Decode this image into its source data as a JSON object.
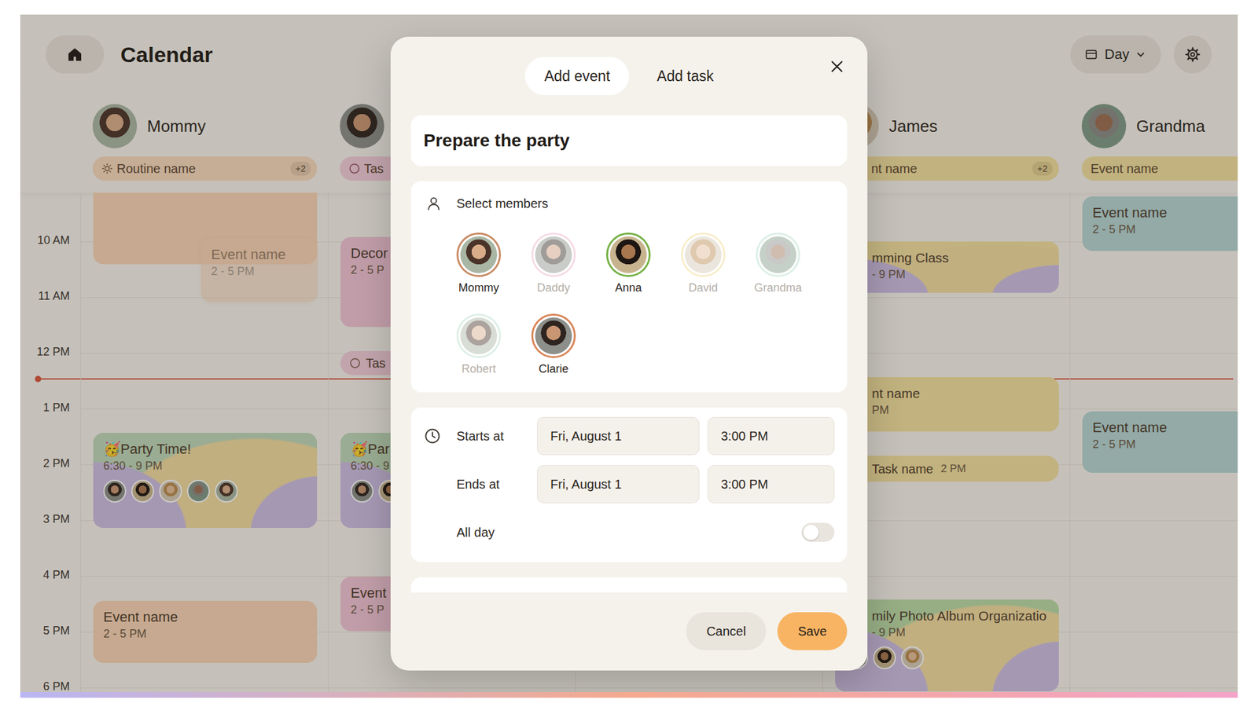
{
  "app": {
    "title": "Calendar",
    "view": "Day"
  },
  "columns": [
    {
      "name": "Mommy",
      "chip": {
        "kind": "routine",
        "label": "Routine name",
        "badge": "+2",
        "color": "#f6d8bd"
      },
      "events": [
        {
          "kind": "block",
          "title": null,
          "time": null,
          "color": "#f6d3b4",
          "attendees": 0
        },
        {
          "kind": "ghost",
          "title": "Event name",
          "time": "2 - 5 PM",
          "color": "#f6d3b4",
          "attendees": 0
        },
        {
          "kind": "pattern",
          "title": "🥳Party Time!",
          "time": "6:30 - 9 PM",
          "color": "#bcd6b8",
          "attendees": 5
        },
        {
          "kind": "event",
          "title": "Event name",
          "time": "2 - 5 PM",
          "color": "#f6d3b4",
          "attendees": 0
        }
      ]
    },
    {
      "name": null,
      "chip": {
        "kind": "task",
        "label": "Tas",
        "badge": null,
        "color": "#f1ccdb"
      },
      "events": [
        {
          "kind": "event",
          "title": "Decor",
          "time": "2 - 5 P",
          "color": "#efc3d5",
          "attendees": 0
        },
        {
          "kind": "task",
          "title": "Tas",
          "time": null,
          "color": "#f1ccdb",
          "attendees": 0
        },
        {
          "kind": "pattern",
          "title": "🥳Par",
          "time": "6:30 - 9",
          "color": "#bcd6b8",
          "attendees": 5
        },
        {
          "kind": "event",
          "title": "Event",
          "time": "2 - 5 P",
          "color": "#efc3d5",
          "attendees": 0
        }
      ]
    },
    {
      "name": null,
      "chip": null,
      "events": []
    },
    {
      "name": "James",
      "chip": {
        "kind": "event",
        "label": "nt name",
        "badge": "+2",
        "color": "#f1df9e"
      },
      "events": [
        {
          "kind": "pattern",
          "title": "mming Class",
          "time": "- 9 PM",
          "color": "#f1df9e",
          "attendees": 0
        },
        {
          "kind": "event",
          "title": "nt name",
          "time": "PM",
          "color": "#f1df9e",
          "attendees": 0
        },
        {
          "kind": "task",
          "title": "Task name",
          "time": "2 PM",
          "color": "#f1df9e",
          "attendees": 0
        },
        {
          "kind": "pattern",
          "title": "mily Photo Album Organizatio",
          "time": "- 9 PM",
          "color": "#b9d9a6",
          "attendees": 3
        }
      ]
    },
    {
      "name": "Grandma",
      "chip": {
        "kind": "event",
        "label": "Event name",
        "badge": null,
        "color": "#f1df9e"
      },
      "events": [
        {
          "kind": "event",
          "title": "Event name",
          "time": "2 - 5 PM",
          "color": "#b3d4d3",
          "attendees": 0
        },
        {
          "kind": "event",
          "title": "Event name",
          "time": "2 - 5 PM",
          "color": "#b3d4d3",
          "attendees": 0
        }
      ]
    }
  ],
  "hours": [
    "10 AM",
    "11 AM",
    "12 PM",
    "1 PM",
    "2 PM",
    "3 PM",
    "4 PM",
    "5 PM",
    "6 PM"
  ],
  "modal": {
    "tabs": [
      {
        "label": "Add event",
        "selected": true
      },
      {
        "label": "Add task",
        "selected": false
      }
    ],
    "title": "Prepare the party",
    "members": {
      "label": "Select members",
      "items": [
        {
          "name": "Mommy",
          "selected": true,
          "color": "#c88a63"
        },
        {
          "name": "Daddy",
          "selected": false,
          "color": "#eab3c6"
        },
        {
          "name": "Anna",
          "selected": true,
          "color": "#74b043"
        },
        {
          "name": "David",
          "selected": false,
          "color": "#f1d98e"
        },
        {
          "name": "Grandma",
          "selected": false,
          "color": "#b6ddca"
        },
        {
          "name": "Robert",
          "selected": false,
          "color": "#b6ddca"
        },
        {
          "name": "Clarie",
          "selected": true,
          "color": "#d98558"
        }
      ]
    },
    "schedule": [
      {
        "label": "Starts at",
        "date": "Fri, August 1",
        "time": "3:00 PM"
      },
      {
        "label": "Ends at",
        "date": "Fri, August 1",
        "time": "3:00 PM"
      }
    ],
    "all_day": {
      "label": "All day",
      "on": false
    },
    "buttons": [
      {
        "label": "Cancel",
        "kind": "secondary"
      },
      {
        "label": "Save",
        "kind": "primary"
      }
    ]
  }
}
